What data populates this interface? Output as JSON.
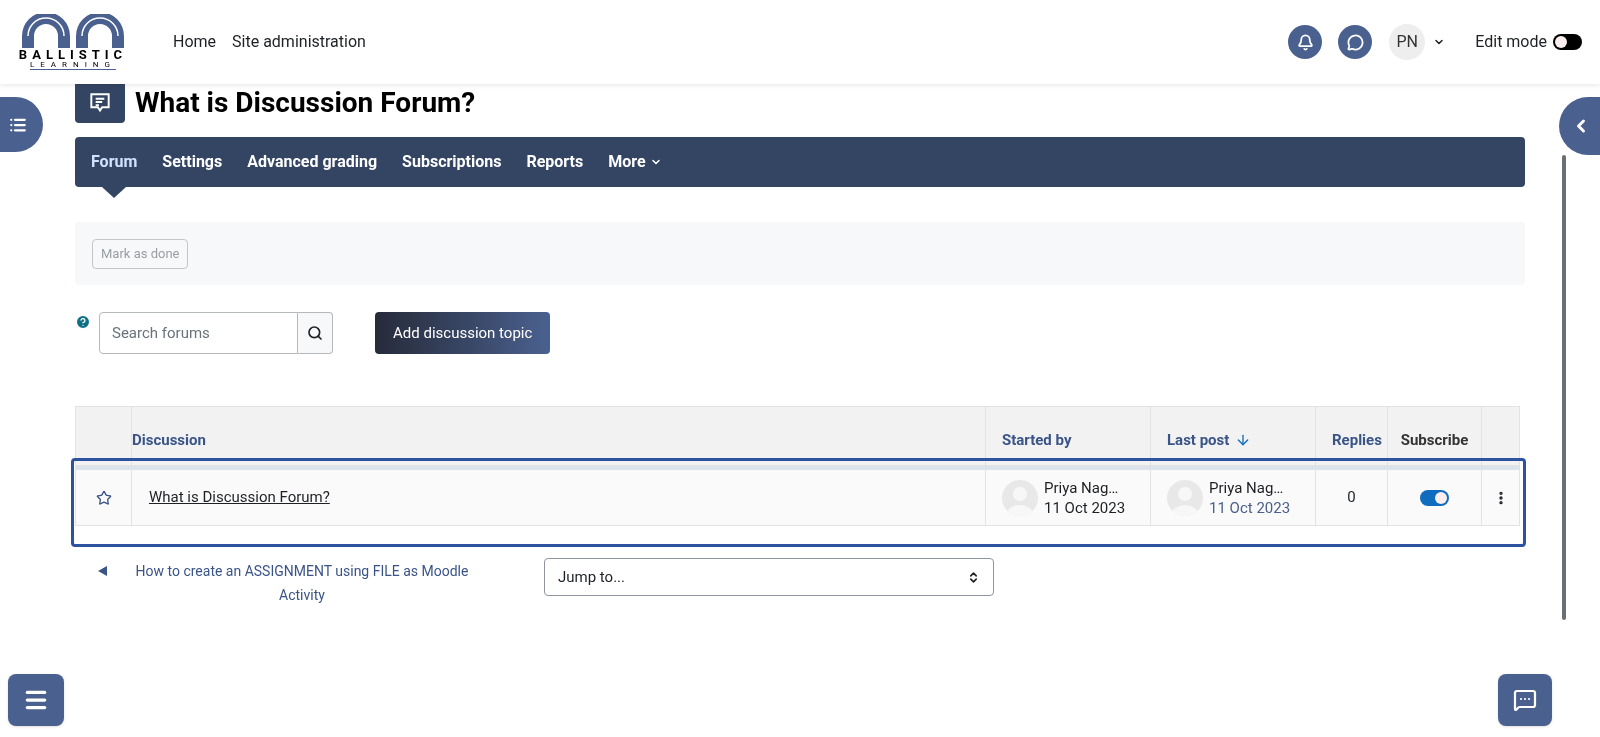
{
  "header": {
    "logo": {
      "line_1": "BALLISTIC",
      "line_2": "LEARNING"
    },
    "nav": [
      {
        "label": "Home"
      },
      {
        "label": "Site administration"
      }
    ],
    "user_initials": "PN",
    "edit_mode": {
      "label": "Edit mode",
      "on": false
    }
  },
  "page_title": "What is Discussion Forum?",
  "tabs": [
    {
      "label": "Forum",
      "selected": true
    },
    {
      "label": "Settings",
      "selected": false
    },
    {
      "label": "Advanced grading",
      "selected": false
    },
    {
      "label": "Subscriptions",
      "selected": false
    },
    {
      "label": "Reports",
      "selected": false
    },
    {
      "label": "More",
      "selected": false,
      "kind": "dropdown"
    }
  ],
  "completion": {
    "button": "Mark as done",
    "disabled": true
  },
  "search": {
    "placeholder": "Search forums"
  },
  "add_button": "Add discussion topic",
  "table": {
    "columns": [
      {
        "label": "Discussion",
        "kind": "link",
        "sorted": false
      },
      {
        "label": "Started by",
        "kind": "link",
        "sorted": false
      },
      {
        "label": "Last post",
        "kind": "link",
        "sorted": true
      },
      {
        "label": "Replies",
        "kind": "link",
        "sorted": false
      },
      {
        "label": "Subscribe",
        "kind": "plain",
        "sorted": false
      }
    ],
    "rows": [
      {
        "starred": false,
        "title": "What is Discussion Forum?",
        "started_by": {
          "name": "Priya Nag…",
          "date": "11 Oct 2023"
        },
        "last_post": {
          "name": "Priya Nag…",
          "date": "11 Oct 2023"
        },
        "replies": "0",
        "subscribed": true
      }
    ]
  },
  "footer": {
    "previous_link": "How to create an ASSIGNMENT using FILE as Moodle Activity",
    "jump_placeholder": "Jump to..."
  }
}
